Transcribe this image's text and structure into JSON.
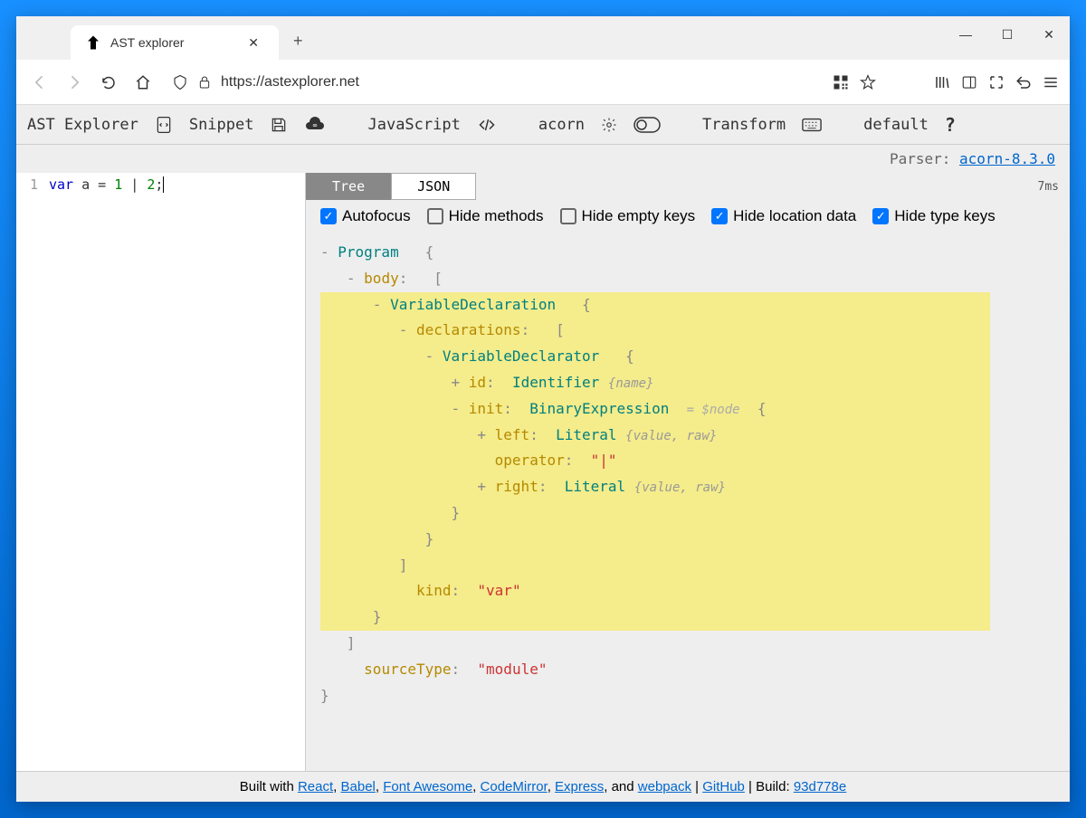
{
  "browser": {
    "tab_title": "AST explorer",
    "url": "https://astexplorer.net"
  },
  "app": {
    "title": "AST Explorer",
    "snippet_label": "Snippet",
    "language": "JavaScript",
    "parser": "acorn",
    "transform_label": "Transform",
    "mode_label": "default",
    "parser_label": "Parser:",
    "parser_version": "acorn-8.3.0"
  },
  "editor": {
    "line_no": "1",
    "kw": "var",
    "code_rest": " a = ",
    "n1": "1",
    "pipe": " | ",
    "n2": "2",
    "semi": ";"
  },
  "view": {
    "tree_tab": "Tree",
    "json_tab": "JSON",
    "parse_time": "7ms"
  },
  "options": {
    "autofocus": "Autofocus",
    "hide_methods": "Hide methods",
    "hide_empty_keys": "Hide empty keys",
    "hide_location": "Hide location data",
    "hide_type_keys": "Hide type keys"
  },
  "ast": {
    "program": "Program",
    "body": "body",
    "varDecl": "VariableDeclaration",
    "declarations": "declarations",
    "varDeclarator": "VariableDeclarator",
    "id": "id",
    "identifier": "Identifier",
    "id_props": "{name}",
    "init": "init",
    "binaryExpr": "BinaryExpression",
    "nodeRef": "= $node",
    "left": "left",
    "literal": "Literal",
    "lit_props": "{value, raw}",
    "operator_key": "operator",
    "operator_val": "\"|\"",
    "right": "right",
    "kind_key": "kind",
    "kind_val": "\"var\"",
    "sourceType_key": "sourceType",
    "sourceType_val": "\"module\""
  },
  "footer": {
    "prefix": "Built with ",
    "react": "React",
    "babel": "Babel",
    "fa": "Font Awesome",
    "cm": "CodeMirror",
    "express": "Express",
    "and": ", and ",
    "webpack": "webpack",
    "sep1": " | ",
    "github": "GitHub",
    "sep2": " | Build: ",
    "build": "93d778e",
    "comma": ", "
  }
}
